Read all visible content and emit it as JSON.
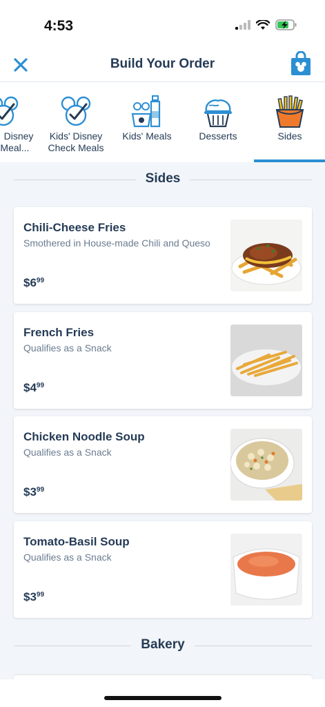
{
  "status_bar": {
    "time": "4:53",
    "icons": [
      "signal-icon",
      "wifi-icon",
      "battery-charging-icon"
    ]
  },
  "header": {
    "title": "Build Your Order",
    "close_icon": "close-icon",
    "bag_icon": "shopping-bag-icon"
  },
  "tabs": [
    {
      "label": "Disney\nk Meal...",
      "icon": "mickey-check-icon"
    },
    {
      "label": "Kids' Disney\nCheck Meals",
      "icon": "mickey-check-icon"
    },
    {
      "label": "Kids' Meals",
      "icon": "kids-meal-icon"
    },
    {
      "label": "Desserts",
      "icon": "cupcake-icon"
    },
    {
      "label": "Sides",
      "icon": "fries-icon",
      "selected": true
    }
  ],
  "sections": [
    {
      "title": "Sides",
      "items": [
        {
          "name": "Chili-Cheese Fries",
          "description": "Smothered in House-made Chili and Queso",
          "price_main": "$6",
          "price_cents": "99"
        },
        {
          "name": "French Fries",
          "description": "Qualifies as a Snack",
          "price_main": "$4",
          "price_cents": "99"
        },
        {
          "name": "Chicken Noodle Soup",
          "description": "Qualifies as a Snack",
          "price_main": "$3",
          "price_cents": "99"
        },
        {
          "name": "Tomato-Basil Soup",
          "description": "Qualifies as a Snack",
          "price_main": "$3",
          "price_cents": "99"
        }
      ]
    },
    {
      "title": "Bakery",
      "items": []
    }
  ],
  "colors": {
    "accent": "#2c8fd3",
    "text": "#253b56",
    "muted": "#6b7c90",
    "background": "#f2f5f9"
  }
}
